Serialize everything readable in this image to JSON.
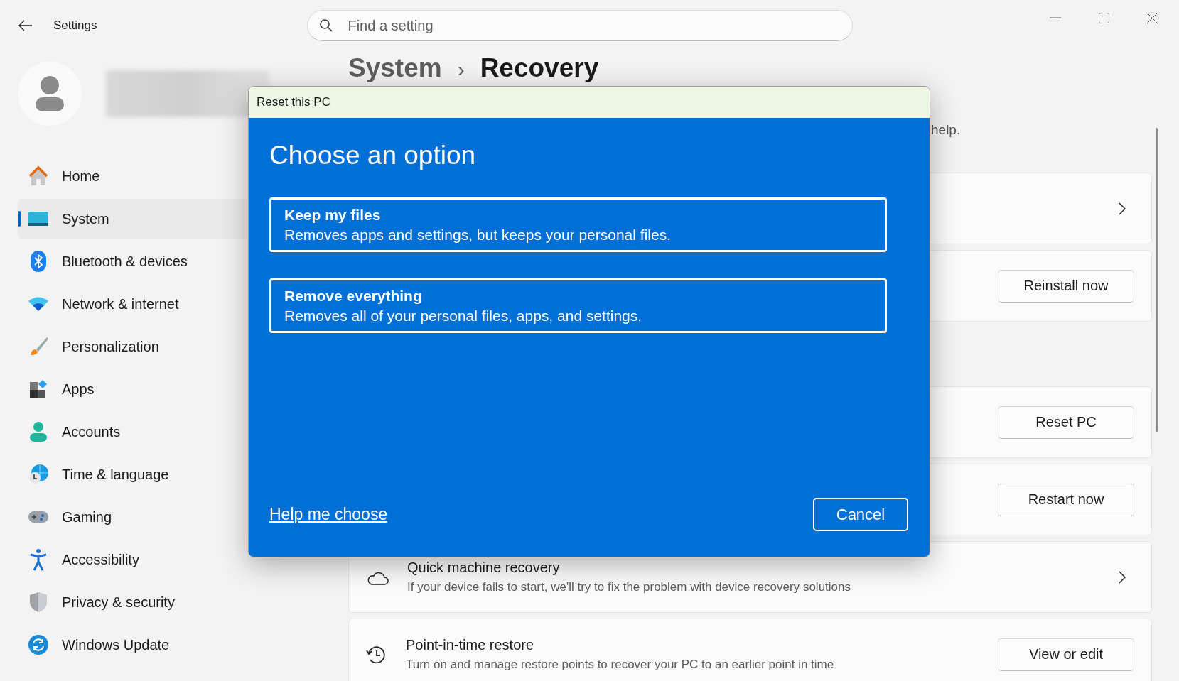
{
  "window": {
    "title": "Settings"
  },
  "search": {
    "placeholder": "Find a setting"
  },
  "sidebar": {
    "items": [
      {
        "label": "Home",
        "selected": false
      },
      {
        "label": "System",
        "selected": true
      },
      {
        "label": "Bluetooth & devices",
        "selected": false
      },
      {
        "label": "Network & internet",
        "selected": false
      },
      {
        "label": "Personalization",
        "selected": false
      },
      {
        "label": "Apps",
        "selected": false
      },
      {
        "label": "Accounts",
        "selected": false
      },
      {
        "label": "Time & language",
        "selected": false
      },
      {
        "label": "Gaming",
        "selected": false
      },
      {
        "label": "Accessibility",
        "selected": false
      },
      {
        "label": "Privacy & security",
        "selected": false
      },
      {
        "label": "Windows Update",
        "selected": false
      }
    ]
  },
  "breadcrumb": {
    "parent": "System",
    "separator": "›",
    "current": "Recovery"
  },
  "description": "help.",
  "cards": [
    {
      "kind": "chevron"
    },
    {
      "kind": "button",
      "button": "Reinstall now"
    },
    {
      "kind": "gap"
    },
    {
      "kind": "button",
      "button": "Reset PC"
    },
    {
      "kind": "button",
      "button": "Restart now"
    },
    {
      "kind": "chevron",
      "title": "Quick machine recovery",
      "subtitle": "If your device fails to start, we'll try to fix the problem with device recovery solutions"
    },
    {
      "kind": "button",
      "title": "Point-in-time restore",
      "subtitle": "Turn on and manage restore points to recover your PC to an earlier point in time",
      "button": "View or edit"
    }
  ],
  "dialog": {
    "title": "Reset this PC",
    "heading": "Choose an option",
    "options": [
      {
        "title": "Keep my files",
        "description": "Removes apps and settings, but keeps your personal files."
      },
      {
        "title": "Remove everything",
        "description": "Removes all of your personal files, apps, and settings."
      }
    ],
    "link": "Help me choose",
    "button": "Cancel"
  }
}
